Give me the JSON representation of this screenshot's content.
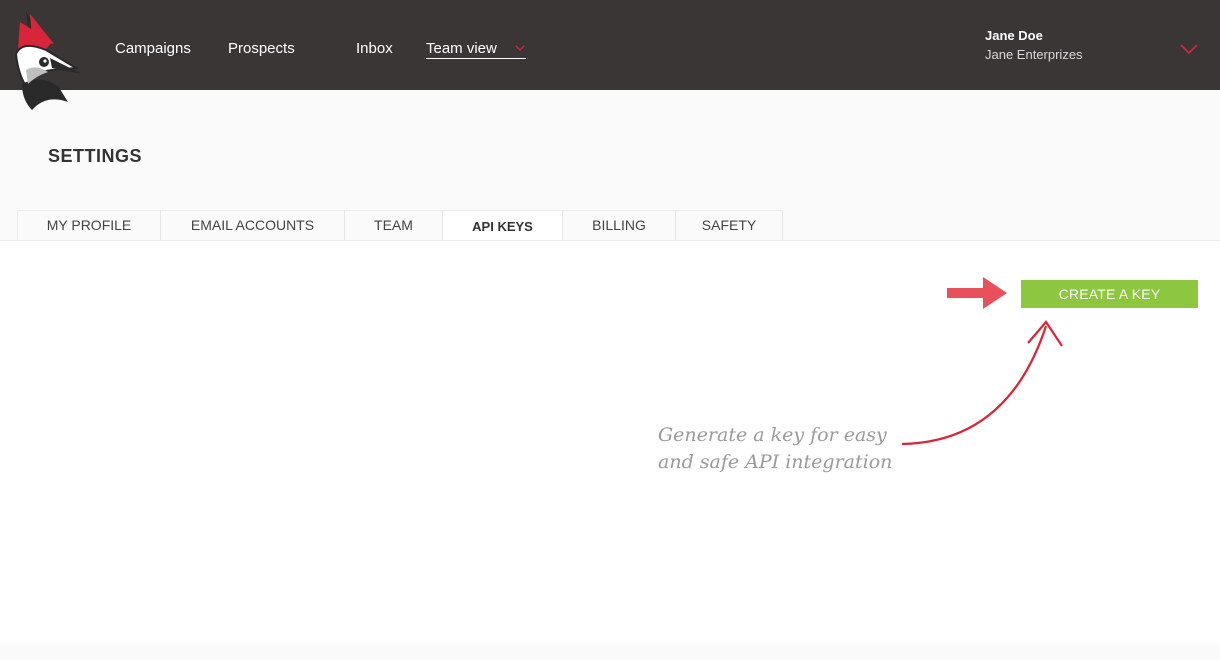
{
  "header": {
    "nav": {
      "campaigns": "Campaigns",
      "prospects": "Prospects",
      "inbox": "Inbox",
      "team_view": "Team view"
    },
    "user": {
      "name": "Jane Doe",
      "company": "Jane Enterprizes"
    },
    "logo_icon": "woodpecker-logo",
    "accent_color": "#d9253a"
  },
  "page": {
    "title": "SETTINGS",
    "tabs": [
      {
        "label": "MY PROFILE",
        "active": false
      },
      {
        "label": "EMAIL ACCOUNTS",
        "active": false
      },
      {
        "label": "TEAM",
        "active": false
      },
      {
        "label": "API KEYS",
        "active": true
      },
      {
        "label": "BILLING",
        "active": false
      },
      {
        "label": "SAFETY",
        "active": false
      }
    ]
  },
  "main": {
    "create_button": "CREATE A KEY",
    "button_color": "#8dc63f",
    "hint_line1": "Generate a key for easy",
    "hint_line2": "and safe API integration",
    "arrow_color": "#e8505b"
  }
}
